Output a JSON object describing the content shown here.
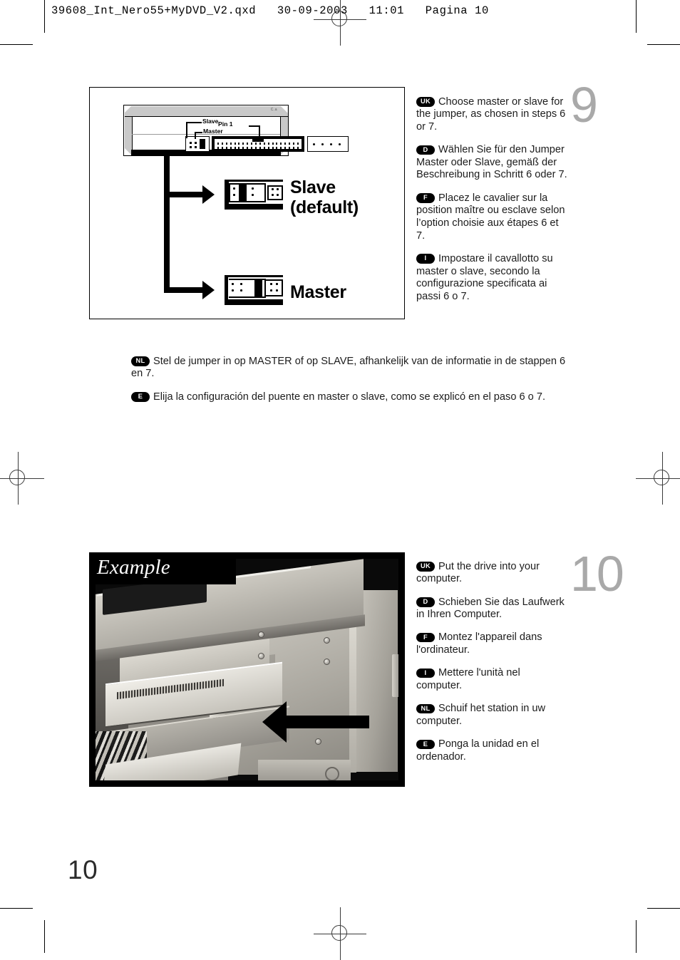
{
  "document": {
    "header_line": "39608_Int_Nero55+MyDVD_V2.qxd   30-09-2003   11:01   Pagina 10",
    "page_number": "10"
  },
  "step9": {
    "number": "9",
    "panel": {
      "drive_labels": {
        "slave": "Slave",
        "master": "Master",
        "pin1": "Pin 1"
      },
      "options": [
        {
          "label_line1": "Slave",
          "label_line2": "(default)"
        },
        {
          "label_line1": "Master",
          "label_line2": ""
        }
      ]
    },
    "instructions": [
      {
        "lang": "UK",
        "text": "Choose master or slave for the jumper, as chosen in steps 6 or 7."
      },
      {
        "lang": "D",
        "text": "Wählen Sie für den Jumper Master oder Slave, gemäß der Beschreibung in Schritt 6 oder 7."
      },
      {
        "lang": "F",
        "text": "Placez le cavalier sur la position maître ou esclave selon l’option choisie aux étapes 6 et 7."
      },
      {
        "lang": "I",
        "text": "Impostare il cavallotto su master o slave, secondo la configurazione specificata ai passi 6 o 7."
      }
    ],
    "instructions_wide": [
      {
        "lang": "NL",
        "text": "Stel de jumper in op MASTER of op SLAVE, afhankelijk van de informatie in de stappen 6 en 7."
      },
      {
        "lang": "E",
        "text": "Elija la configuración del puente en master o slave, como se explicó en el paso 6 o 7."
      }
    ]
  },
  "step10": {
    "number": "10",
    "photo": {
      "caption": "Example"
    },
    "instructions": [
      {
        "lang": "UK",
        "text": "Put the drive into your computer."
      },
      {
        "lang": "D",
        "text": "Schieben Sie das Laufwerk in Ihren Computer."
      },
      {
        "lang": "F",
        "text": "Montez l'appareil dans l'ordinateur."
      },
      {
        "lang": "I",
        "text": "Mettere l'unità nel computer."
      },
      {
        "lang": "NL",
        "text": "Schuif het station in uw computer."
      },
      {
        "lang": "E",
        "text": "Ponga la unidad en el ordenador."
      }
    ]
  },
  "colors": {
    "step_number": "#a9a9a9",
    "ink": "#000000",
    "paper": "#ffffff"
  }
}
